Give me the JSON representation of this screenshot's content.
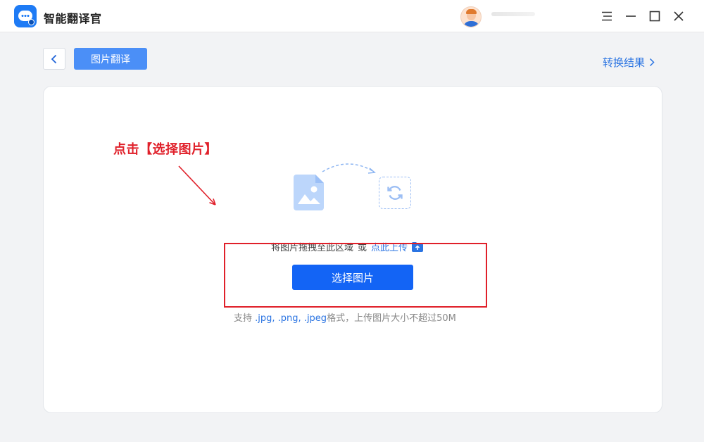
{
  "app": {
    "title": "智能翻译官",
    "icon": "chat-bubble-logo",
    "accent_color": "#1364f5"
  },
  "titlebar": {
    "icons": [
      "menu-icon",
      "minimize-icon",
      "maximize-icon",
      "close-icon"
    ]
  },
  "nav": {
    "back_icon": "chevron-left-icon",
    "tab_label": "图片翻译",
    "convert_result_label": "转换结果",
    "convert_result_icon": "chevron-right-icon"
  },
  "upload": {
    "annotation": "点击【选择图片】",
    "annotation_color": "#e0202a",
    "drop_hint": "将图片拖拽至此区域",
    "or_text": "或",
    "upload_link": "点此上传",
    "upload_icon": "upload-icon",
    "select_button": "选择图片",
    "support_prefix": "支持",
    "support_formats": ".jpg, .png, .jpeg",
    "support_suffix": "格式，上传图片大小不超过50M"
  }
}
